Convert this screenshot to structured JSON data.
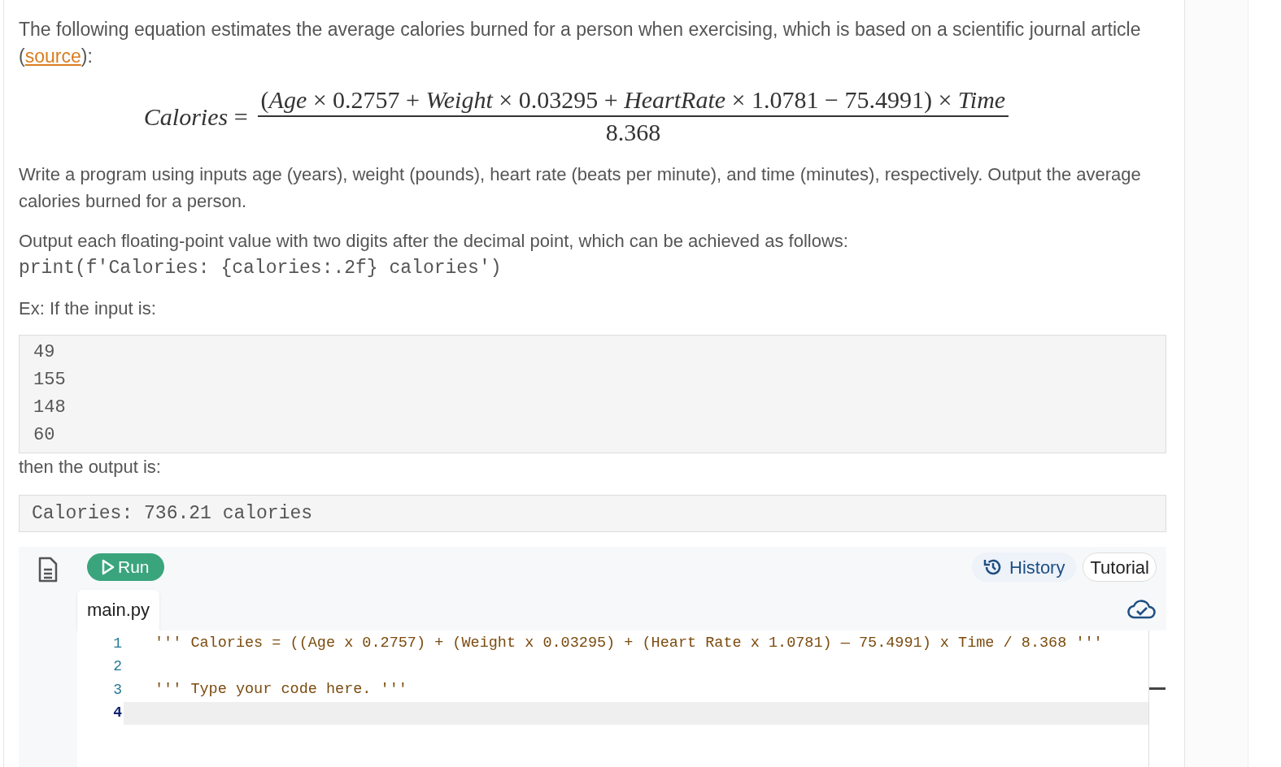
{
  "intro": {
    "text": "The following equation estimates the average calories burned for a person when exercising, which is based on a scientific journal article (",
    "link": "source",
    "after": "):"
  },
  "equation": {
    "lhs": "*Calories* =",
    "numerator": "(*Age* × 0.2757 + *Weight* × 0.03295 + *HeartRate* × 1.0781 − 75.4991) × *Time*",
    "denominator": "8.368"
  },
  "task": "Write a program using inputs age (years), weight (pounds), heart rate (beats per minute), and time (minutes), respectively. Output the average calories burned for a person.",
  "format_note": "Output each floating-point value with two digits after the decimal point, which can be achieved as follows:",
  "format_code": "print(f'Calories: {calories:.2f} calories')",
  "example_intro": "Ex: If the input is:",
  "example_input": [
    "49",
    "155",
    "148",
    "60"
  ],
  "output_intro": "then the output is:",
  "example_output": "Calories: 736.21 calories",
  "editor": {
    "run_label": "Run",
    "history_label": "History",
    "tutorial_label": "Tutorial",
    "file_tab": "main.py",
    "lines": [
      {
        "number": "1",
        "code": "''' Calories = ((Age x 0.2757) + (Weight x 0.03295) + (Heart Rate x 1.0781) — 75.4991) x Time / 8.368 '''",
        "selected": false
      },
      {
        "number": "2",
        "selected": false
      },
      {
        "number": "3",
        "code": "''' Type your code here. '''",
        "selected": false
      },
      {
        "number": "4",
        "selected": true
      }
    ]
  }
}
